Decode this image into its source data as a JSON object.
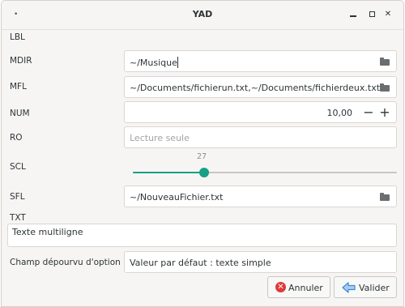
{
  "window": {
    "title": "YAD",
    "menu_glyph": "•",
    "minimize_icon": "window-minimize-icon",
    "maximize_icon": "window-maximize-icon",
    "close_glyph": "✕"
  },
  "form": {
    "lbl": {
      "label": "LBL"
    },
    "mdir": {
      "label": "MDIR",
      "value": "~/Musique",
      "icon": "folder-icon"
    },
    "mfl": {
      "label": "MFL",
      "value": "~/Documents/fichierun.txt,~/Documents/fichierdeux.txt",
      "icon": "folder-icon"
    },
    "num": {
      "label": "NUM",
      "value": "10,00",
      "minus": "−",
      "plus": "+"
    },
    "ro": {
      "label": "RO",
      "placeholder": "Lecture seule"
    },
    "scl": {
      "label": "SCL",
      "value": 27,
      "min": 0,
      "max": 100,
      "accent": "#16a085"
    },
    "sfl": {
      "label": "SFL",
      "value": "~/NouveauFichier.txt",
      "icon": "folder-icon"
    },
    "txt": {
      "label": "TXT",
      "value": "Texte multiligne"
    },
    "champ": {
      "label": "Champ dépourvu d'option",
      "value": "Valeur par défaut : texte simple"
    }
  },
  "buttons": {
    "cancel": {
      "label": "Annuler",
      "icon": "cancel-icon",
      "icon_glyph": "✕",
      "color": "#e0393a"
    },
    "ok": {
      "label": "Valider",
      "icon": "validate-arrow-icon",
      "color": "#3f8ad4"
    }
  }
}
